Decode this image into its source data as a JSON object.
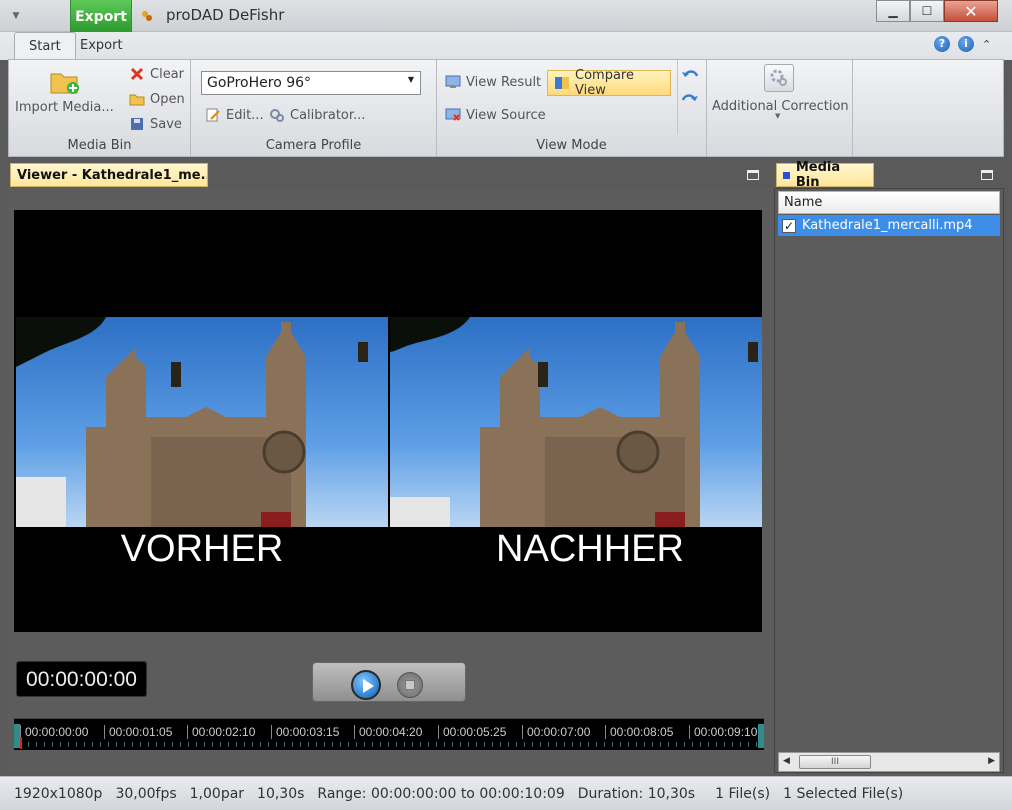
{
  "window": {
    "title": "proDAD DeFishr",
    "export_tab": "Export",
    "buttons": {
      "minimize": "▁",
      "maximize": "☐",
      "close": "✕"
    }
  },
  "ribbon_tabs": [
    "Start",
    "Export"
  ],
  "help_icons": {
    "help": "?",
    "info": "i",
    "collapse": "⌃"
  },
  "media_bin_group": {
    "label": "Media Bin",
    "import_label": "Import Media...",
    "clear_label": "Clear",
    "open_label": "Open",
    "save_label": "Save"
  },
  "camera_profile_group": {
    "label": "Camera Profile",
    "selected_profile": "GoProHero 96°",
    "edit_label": "Edit...",
    "calibrator_label": "Calibrator..."
  },
  "view_mode_group": {
    "label": "View Mode",
    "view_result": "View Result",
    "compare_view": "Compare View",
    "view_source": "View Source",
    "active": "Compare View"
  },
  "additional_correction": {
    "label": "Additional Correction"
  },
  "viewer": {
    "tab_title": "Viewer - Kathedrale1_me...",
    "caption_before": "VORHER",
    "caption_after": "NACHHER",
    "timecode": "00:00:00:00",
    "timeline_ticks": [
      "00:00:00:00",
      "00:00:01:05",
      "00:00:02:10",
      "00:00:03:15",
      "00:00:04:20",
      "00:00:05:25",
      "00:00:07:00",
      "00:00:08:05",
      "00:00:09:10"
    ]
  },
  "media_bin_panel": {
    "tab_title": "Media Bin",
    "column_name": "Name",
    "items": [
      {
        "name": "Kathedrale1_mercalli.mp4",
        "checked": true
      }
    ],
    "scroll_thumb": "III"
  },
  "status": {
    "resolution": "1920x1080p",
    "fps": "30,00fps",
    "par": "1,00par",
    "length": "10,30s",
    "range": "Range: 00:00:00:00 to 00:00:10:09",
    "duration": "Duration: 10,30s",
    "files": "1 File(s)",
    "selected": "1 Selected File(s)"
  },
  "colors": {
    "export_green": "#2c9a2c",
    "highlight": "#ffd97a",
    "selection": "#3d8ee8"
  },
  "icons": [
    "import-media-icon",
    "clear-icon",
    "open-folder-icon",
    "save-icon",
    "edit-icon",
    "calibrator-icon",
    "view-result-icon",
    "compare-view-icon",
    "view-source-icon",
    "undo-icon",
    "redo-icon",
    "additional-correction-icon",
    "play-icon",
    "stop-icon",
    "help-icon",
    "info-icon"
  ]
}
